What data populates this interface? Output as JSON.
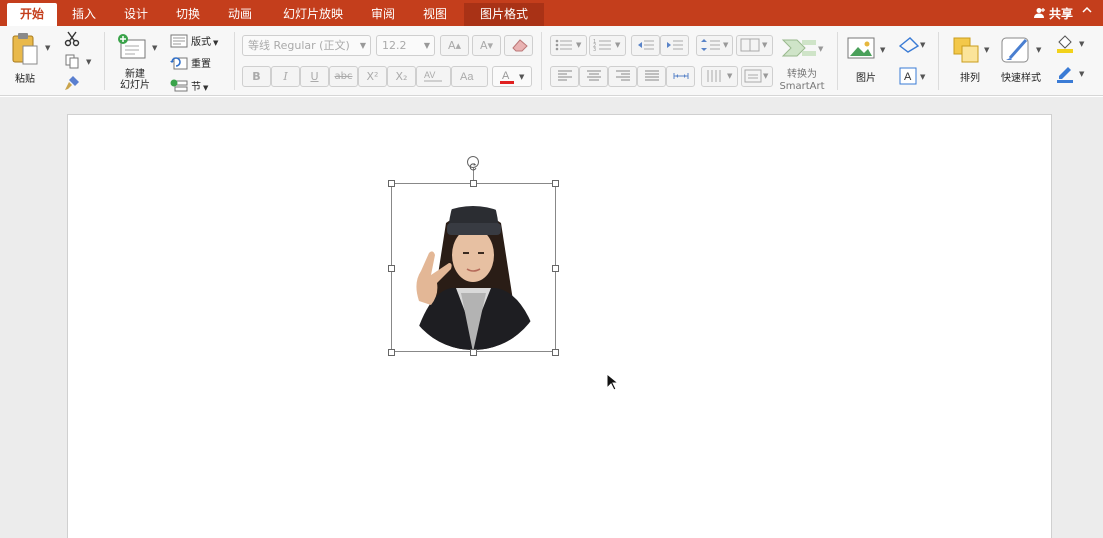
{
  "tabs": [
    {
      "label": "开始",
      "active": true
    },
    {
      "label": "插入"
    },
    {
      "label": "设计"
    },
    {
      "label": "切换"
    },
    {
      "label": "动画"
    },
    {
      "label": "幻灯片放映"
    },
    {
      "label": "审阅"
    },
    {
      "label": "视图"
    },
    {
      "label": "图片格式",
      "contextual": true
    }
  ],
  "share_label": "共享",
  "ribbon": {
    "paste_label": "粘贴",
    "new_slide_label_1": "新建",
    "new_slide_label_2": "幻灯片",
    "layout_label": "版式",
    "reset_label": "重置",
    "section_label": "节",
    "font_name": "等线 Regular (正文)",
    "font_size": "12.2",
    "bold": "B",
    "italic": "I",
    "underline": "U",
    "strike": "abc",
    "superscript": "X²",
    "subscript": "X₂",
    "convert_smartart_1": "转换为",
    "convert_smartart_2": "SmartArt",
    "picture_label": "图片",
    "arrange_label": "排列",
    "quick_styles_label": "快速样式"
  },
  "colors": {
    "accent": "#c43e1c",
    "font_color": "#e02020",
    "highlight": "#f2d21b",
    "ribbon_bg": "#f7f7f7",
    "canvas_bg": "#ececec"
  }
}
